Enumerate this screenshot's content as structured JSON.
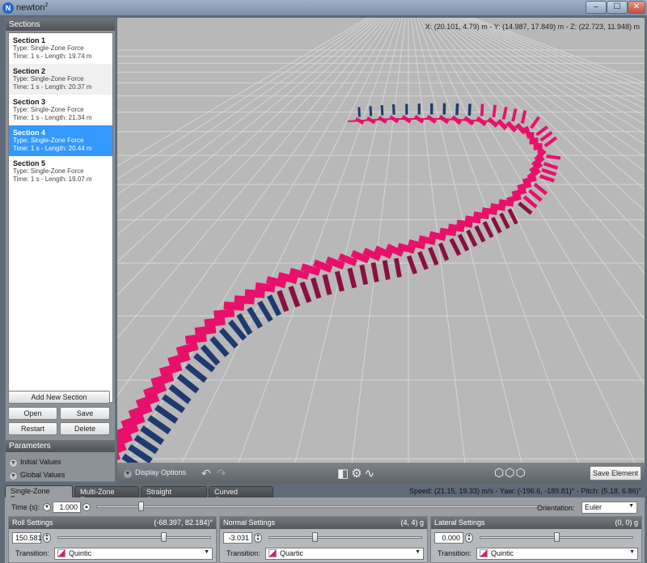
{
  "window": {
    "title": "newton",
    "title_sup": "2",
    "icon_letter": "N",
    "minimize": "–",
    "maximize": "☐",
    "close": "✕"
  },
  "sections": {
    "header": "Sections",
    "items": [
      {
        "title": "Section 1",
        "type": "Type: Single-Zone Force",
        "info": "Time: 1 s - Length: 19.74 m"
      },
      {
        "title": "Section 2",
        "type": "Type: Single-Zone Force",
        "info": "Time: 1 s - Length: 20.37 m"
      },
      {
        "title": "Section 3",
        "type": "Type: Single-Zone Force",
        "info": "Time: 1 s - Length: 21.34 m"
      },
      {
        "title": "Section 4",
        "type": "Type: Single-Zone Force",
        "info": "Time: 1 s - Length: 20.44 m",
        "selected": true
      },
      {
        "title": "Section 5",
        "type": "Type: Single-Zone Force",
        "info": "Time: 1 s - Length: 19.07 m"
      }
    ],
    "buttons": {
      "add": "Add New Section",
      "open": "Open",
      "save": "Save",
      "restart": "Restart",
      "delete": "Delete"
    }
  },
  "parameters": {
    "header": "Parameters",
    "initial": "Initial Values",
    "global": "Global Values"
  },
  "viewport": {
    "coords": "X: (20.101, 4.79) m  -  Y: (14.987, 17.849) m  -  Z: (22.723, 11.948) m",
    "colors": {
      "ground": "#b8b8b8",
      "grid": "#d6d6d6",
      "track_blue": "#1f3a6e",
      "track_pink": "#e8106a",
      "track_dark": "#8a1040"
    }
  },
  "toolbar": {
    "display_options": "Display Options",
    "save_element": "Save Element"
  },
  "tabs": [
    {
      "label": "Single-Zone Force",
      "active": true
    },
    {
      "label": "Multi-Zone Force"
    },
    {
      "label": "Straight Geometry"
    },
    {
      "label": "Curved Geometry"
    }
  ],
  "status": "Speed: (21.15, 19.33) m/s - Yaw: (-196.6, -189.81)° - Pitch: (5.18, 6.86)°",
  "time": {
    "label": "Time (s):",
    "value": "1.000",
    "slider_fraction": 0.1
  },
  "orientation": {
    "label": "Orientation:",
    "value": "Euler"
  },
  "settings": {
    "roll": {
      "title": "Roll Settings",
      "range": "(-68.397, 82.184)°",
      "value": "150.581",
      "slider_fraction": 0.69,
      "transition_label": "Transition:",
      "transition": "Quintic"
    },
    "normal": {
      "title": "Normal Settings",
      "range": "(4, 4) g",
      "value": "-3.031",
      "slider_fraction": 0.3,
      "transition_label": "Transition:",
      "transition": "Quartic"
    },
    "lateral": {
      "title": "Lateral Settings",
      "range": "(0, 0) g",
      "value": "0.000",
      "slider_fraction": 0.5,
      "transition_label": "Transition:",
      "transition": "Quintic"
    }
  }
}
